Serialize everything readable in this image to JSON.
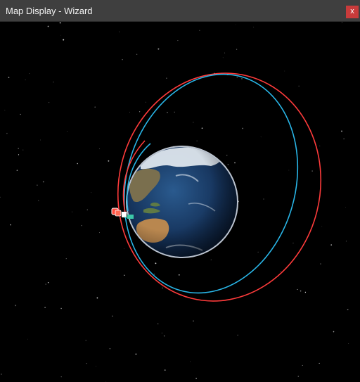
{
  "window": {
    "title": "Map Display - Wizard",
    "close_label": "x"
  },
  "scene": {
    "background": "#000000",
    "earth_ocean": "#1c3e6a",
    "earth_land": "#7a6f4e",
    "earth_ice": "#e8eef4",
    "orbits": [
      {
        "name": "",
        "color": "#ff3b3b"
      },
      {
        "name": "",
        "color": "#29b6e8"
      }
    ],
    "spacecraft": [
      {
        "name": "",
        "color": "#ff4a3d",
        "icon": "satellite-icon"
      },
      {
        "name": "",
        "color": "#3cc7a8",
        "icon": "satellite-icon"
      }
    ]
  }
}
